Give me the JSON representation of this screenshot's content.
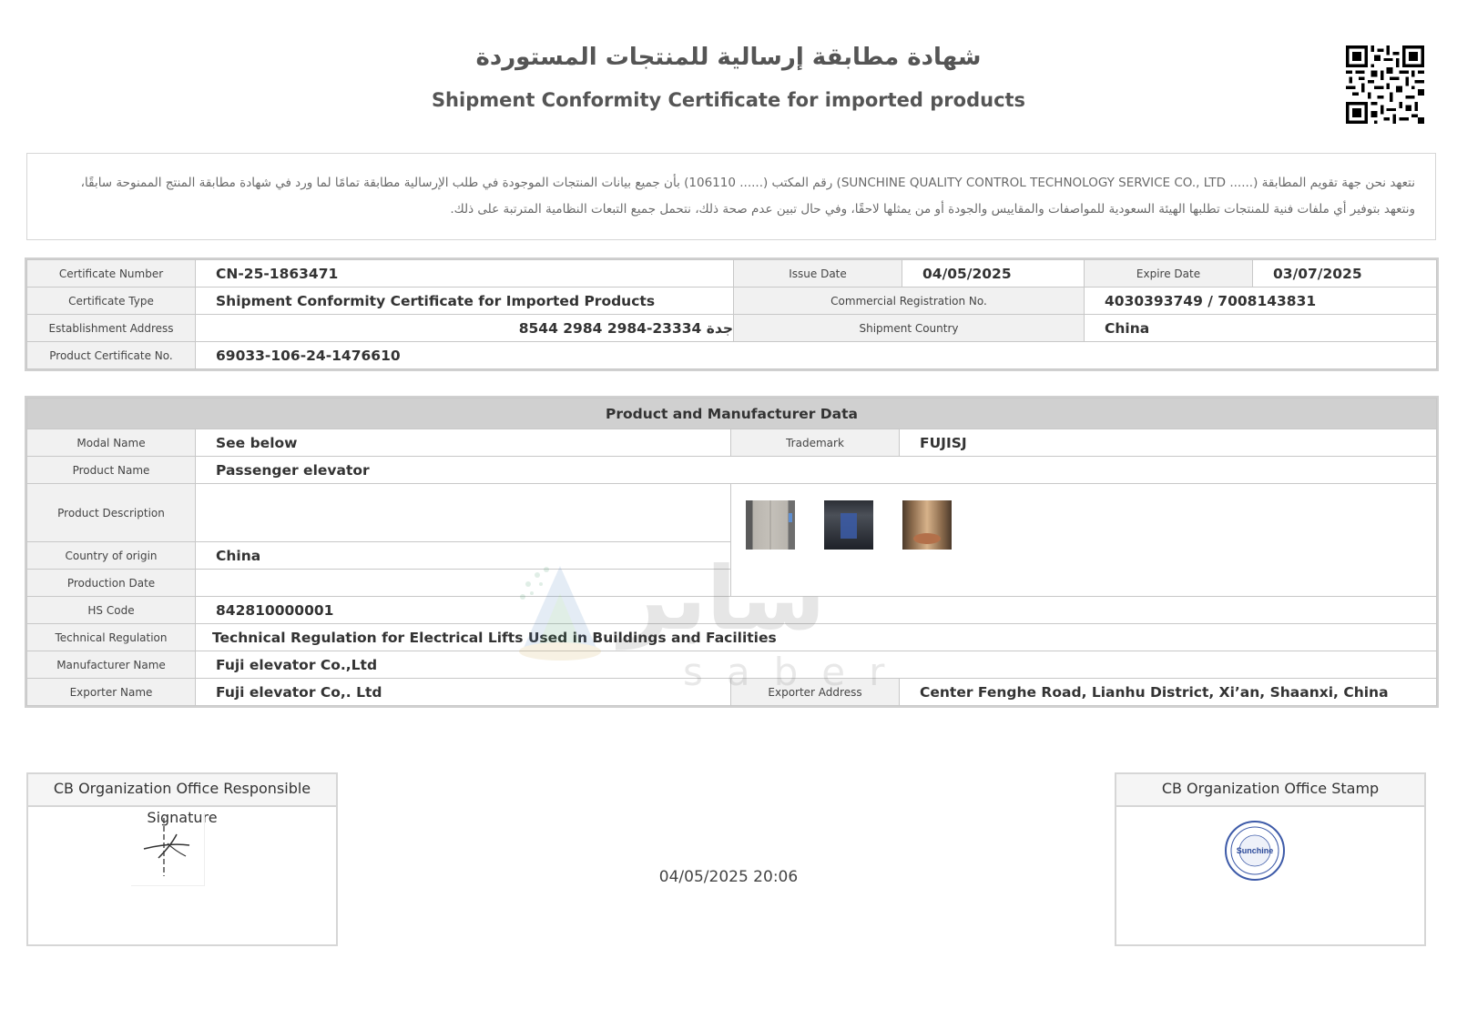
{
  "header": {
    "title_ar": "شهادة مطابقة إرسالية للمنتجات المستوردة",
    "title_en": "Shipment Conformity Certificate for imported products"
  },
  "pledge": {
    "line1": "نتعهد نحن جهة تقويم المطابقة   (...... SUNCHINE QUALITY CONTROL TECHNOLOGY SERVICE CO., LTD)   رقم المكتب   (...... 106110)  بأن جميع بيانات المنتجات الموجودة في طلب الإرسالية مطابقة تمامًا لما ورد في شهادة مطابقة المنتج الممنوحة سابقًا،",
    "line2": "ونتعهد بتوفير أي ملفات فنية للمنتجات تطلبها الهيئة السعودية للمواصفات والمقاييس والجودة أو من يمثلها لاحقًا، وفي حال تبين عدم صحة ذلك، نتحمل جميع التبعات النظامية المترتبة على ذلك."
  },
  "certificate": {
    "number_label": "Certificate Number",
    "number": "CN-25-1863471",
    "issue_label": "Issue Date",
    "issue": "04/05/2025",
    "expire_label": "Expire Date",
    "expire": "03/07/2025",
    "type_label": "Certificate Type",
    "type": "Shipment Conformity Certificate for Imported Products",
    "cr_label": "Commercial Registration No.",
    "cr": "4030393749 / 7008143831",
    "address_label": "Establishment Address",
    "address": "جدة 23334-2984 2984 8544",
    "country_label": "Shipment Country",
    "country": "China",
    "pcert_label": "Product Certificate No.",
    "pcert": "69033-106-24-1476610"
  },
  "product": {
    "section_title": "Product and Manufacturer Data",
    "model_label": "Modal Name",
    "model": "See below",
    "trademark_label": "Trademark",
    "trademark": "FUJISJ",
    "name_label": "Product Name",
    "name": "Passenger elevator",
    "desc_label": "Product Description",
    "desc": "",
    "origin_label": "Country of origin",
    "origin": "China",
    "proddate_label": "Production Date",
    "proddate": "",
    "hs_label": "HS Code",
    "hs": "842810000001",
    "techreg_label": "Technical Regulation",
    "techreg": "Technical Regulation for Electrical Lifts Used in Buildings and Facilities",
    "manufacturer_label": "Manufacturer Name",
    "manufacturer": "Fuji elevator Co.,Ltd",
    "exporter_label": "Exporter Name",
    "exporter": "Fuji elevator Co,. Ltd",
    "exporter_address_label": "Exporter Address",
    "exporter_address": "Center Fenghe Road, Lianhu District, Xi’an, Shaanxi, China"
  },
  "watermark": {
    "word_ar": "سابر",
    "word_latin": "saber"
  },
  "footer": {
    "signature_title": "CB Organization Office Responsible Signature",
    "stamp_title": "CB Organization Office Stamp",
    "stamp_text": "Sunchine",
    "timestamp": "04/05/2025 20:06"
  }
}
